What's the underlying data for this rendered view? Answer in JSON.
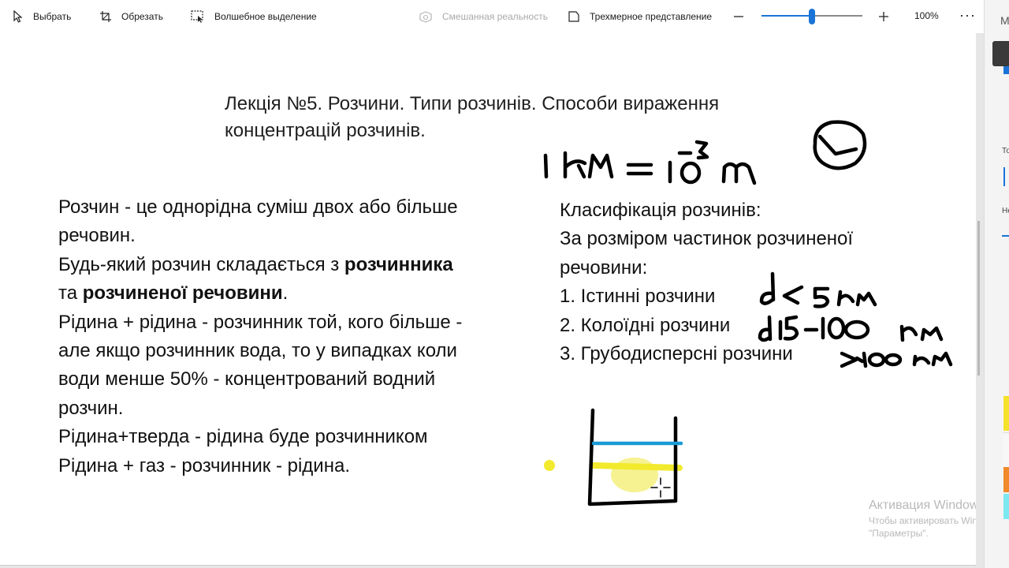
{
  "toolbar": {
    "select_label": "Выбрать",
    "crop_label": "Обрезать",
    "magic_select_label": "Волшебное выделение",
    "mixed_reality_label": "Смешанная реальность",
    "view_3d_label": "Трехмерное представление",
    "zoom_level": "100%",
    "zoom_fraction": 0.5,
    "more_label": "···"
  },
  "right_panel": {
    "header_letter": "М",
    "label_1": "То",
    "label_2": "Не",
    "swatches": [
      "#f5e22a",
      "#f0f0f0",
      "#f08a2a",
      "#7ce8f0"
    ]
  },
  "lecture": {
    "title_line1": "Лекція №5. Розчини. Типи розчинів. Способи вираження",
    "title_line2": "концентрацій розчинів."
  },
  "definition": {
    "line1": "Розчин - це однорідна суміш двох або більше",
    "line2": "речовин.",
    "line3_pre": "Будь-який розчин складається з ",
    "line3_bold": "розчинника",
    "line4_pre": "та ",
    "line4_bold": "розчиненої речовини",
    "line4_post": ".",
    "line5": "Рідина + рідина - розчинник той, кого більше -",
    "line6": "але якщо розчинник вода, то у випадках коли",
    "line7": "води менше 50% - концентрований водний",
    "line8": "розчин.",
    "line9": "Рідина+тверда - рідина буде розчинником",
    "line10": "Рідина + газ - розчинник - рідина."
  },
  "classification": {
    "heading": "Класифікація розчинів:",
    "by_size_line1": "За розміром частинок розчиненої",
    "by_size_line2": "речовини:",
    "item1": "1. Істинні розчини",
    "item2": "2. Колоїдні розчини",
    "item3": "3. Грубодисперсні розчини"
  },
  "colors": {
    "accent": "#1a74d8",
    "ink": "#000000",
    "water_line": "#1a9ad6",
    "yellow_highlight": "#f2ea2c"
  },
  "watermark": {
    "line1": "Активация Windows",
    "line2": "Чтобы активировать Windows",
    "line3": "\"Параметры\"."
  }
}
